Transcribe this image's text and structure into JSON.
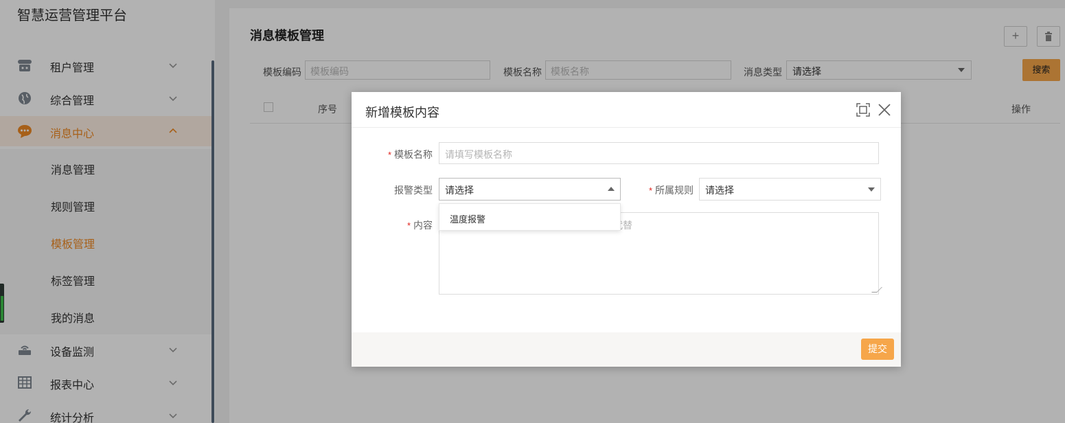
{
  "app": {
    "title": "智慧运营管理平台"
  },
  "sidebar": {
    "items": [
      {
        "label": "租户管理",
        "icon": "user-group-icon"
      },
      {
        "label": "综合管理",
        "icon": "globe-icon"
      },
      {
        "label": "消息中心",
        "icon": "chat-bubble-icon"
      },
      {
        "label": "设备监测",
        "icon": "router-icon"
      },
      {
        "label": "报表中心",
        "icon": "table-grid-icon"
      },
      {
        "label": "统计分析",
        "icon": "wrench-icon"
      }
    ],
    "subitems": [
      {
        "label": "消息管理"
      },
      {
        "label": "规则管理"
      },
      {
        "label": "模板管理"
      },
      {
        "label": "标签管理"
      },
      {
        "label": "我的消息"
      }
    ],
    "active_item": "消息中心",
    "current_subitem": "模板管理"
  },
  "page": {
    "title": "消息模板管理",
    "toolbar": {
      "add_icon": "+",
      "delete_icon": "🗑"
    },
    "filters": {
      "code_label": "模板编码",
      "code_placeholder": "模板编码",
      "name_label": "模板名称",
      "name_placeholder": "模板名称",
      "type_label": "消息类型",
      "type_value": "请选择",
      "search_label": "搜索"
    },
    "table": {
      "columns": [
        "序号",
        "操作"
      ]
    }
  },
  "modal": {
    "title": "新增模板内容",
    "fields": {
      "name_label": "模板名称",
      "name_placeholder": "请填写模板名称",
      "alarm_type_label": "报警类型",
      "alarm_type_value": "请选择",
      "rule_label": "所属规则",
      "rule_value": "请选择",
      "content_label": "内容",
      "content_placeholder_visible": "代替"
    },
    "dropdown_options": [
      "温度报警"
    ],
    "submit_label": "提交"
  },
  "colors": {
    "accent": "#f08a24",
    "button": "#f6a64a",
    "required": "#e0231d"
  }
}
